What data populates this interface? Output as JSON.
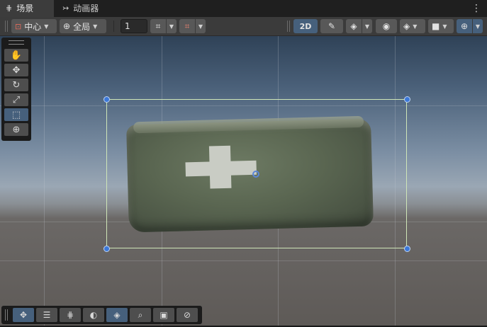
{
  "tabs": [
    {
      "label": "场景",
      "icon": "grid-icon"
    },
    {
      "label": "动画器",
      "icon": "animator-icon"
    }
  ],
  "toolbar": {
    "pivot_mode": "中心",
    "pivot_space": "全局",
    "snap_increment": "1",
    "mode_2d_label": "2D"
  },
  "tool_palette": [
    "view-tool",
    "move-tool",
    "rotate-tool",
    "scale-tool",
    "rect-tool",
    "transform-tool"
  ],
  "selected_tool": "rect-tool",
  "colors": {
    "accent": "#46607c",
    "selection_rect": "#cfe6b8",
    "handle": "#3c78d8"
  }
}
